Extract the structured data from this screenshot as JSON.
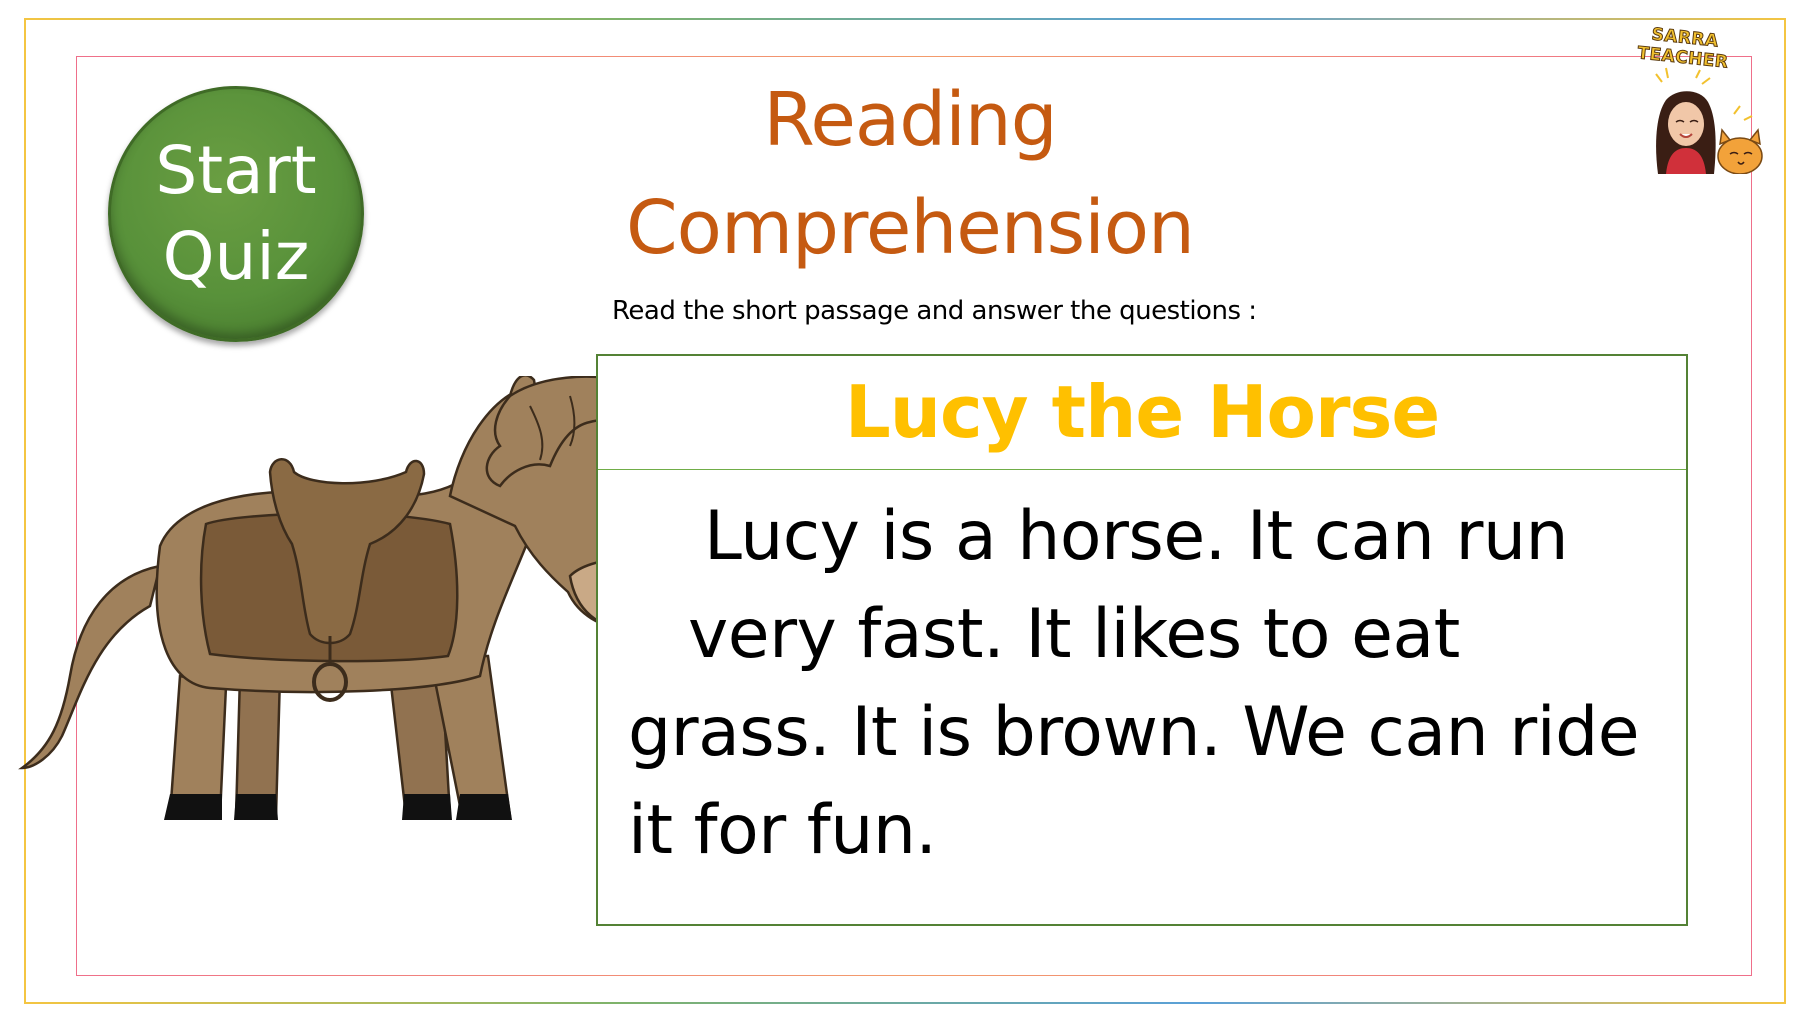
{
  "slide": {
    "start_button": {
      "line1": "Start",
      "line2": "Quiz"
    },
    "title": {
      "line1": "Reading",
      "line2": "Comprehension"
    },
    "instruction": "Read the short passage and answer the questions :",
    "passage": {
      "title": "Lucy the Horse",
      "lines": [
        "Lucy is a horse. It can run",
        "very fast. It likes to eat",
        "grass. It is brown. We can ride",
        "it for fun."
      ]
    },
    "badge": {
      "label": "SARRA TEACHER"
    }
  },
  "colors": {
    "title": "#c55a11",
    "passage_title": "#ffc000",
    "button_green": "#58913a",
    "box_border": "#548235",
    "horse_body": "#a0815c",
    "saddle": "#7a5a38"
  },
  "icons": {
    "horse": "horse-illustration",
    "badge": "teacher-avatar-with-cat"
  }
}
